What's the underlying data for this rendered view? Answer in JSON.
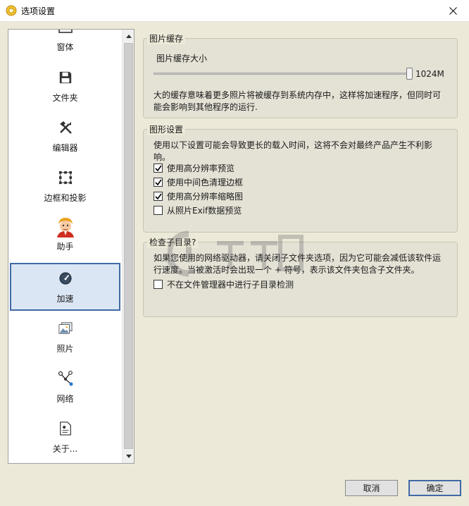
{
  "window": {
    "title": "选项设置"
  },
  "sidebar": {
    "items": [
      {
        "label": "窗体",
        "icon": "window-icon"
      },
      {
        "label": "文件夹",
        "icon": "floppy-disk-icon"
      },
      {
        "label": "编辑器",
        "icon": "tools-icon"
      },
      {
        "label": "边框和投影",
        "icon": "border-shadow-icon"
      },
      {
        "label": "助手",
        "icon": "assistant-avatar-icon"
      },
      {
        "label": "加速",
        "icon": "speedometer-icon",
        "selected": true
      },
      {
        "label": "照片",
        "icon": "photo-icon"
      },
      {
        "label": "网络",
        "icon": "network-icon"
      },
      {
        "label": "关于...",
        "icon": "about-document-icon"
      }
    ]
  },
  "cache_group": {
    "title": "图片缓存",
    "size_label": "图片缓存大小",
    "slider_value": "1024M",
    "slider_fraction": 1.0,
    "desc_line1": "大的缓存意味着更多照片将被缓存到系统内存中，这样将加速程序，但同时可",
    "desc_line2": "能会影响到其他程序的运行."
  },
  "graphics_group": {
    "title": "图形设置",
    "desc_line1": "使用以下设置可能会导致更长的载入时间，这将不会对最终产品产生不利影",
    "desc_line2": "响。",
    "options": [
      {
        "label": "使用高分辨率预览",
        "checked": true
      },
      {
        "label": "使用中间色清理边框",
        "checked": true
      },
      {
        "label": "使用高分辨率缩略图",
        "checked": true
      },
      {
        "label": "从照片Exif数据预览",
        "checked": false
      }
    ]
  },
  "subdir_group": {
    "title": "检查子目录?",
    "desc_line1": "如果您使用的网络驱动器，请关闭子文件夹选项，因为它可能会减低该软件运",
    "desc_line2": "行速度。当被激活时会出现一个 + 符号，表示该文件夹包含子文件夹。",
    "option_label": "不在文件管理器中进行子目录检测",
    "option_checked": false
  },
  "buttons": {
    "cancel": "取消",
    "ok": "确定"
  },
  "colors": {
    "selected_border": "#3f6aa5",
    "selected_bg": "#dbe6f4",
    "panel_bg": "#ece9d8"
  }
}
